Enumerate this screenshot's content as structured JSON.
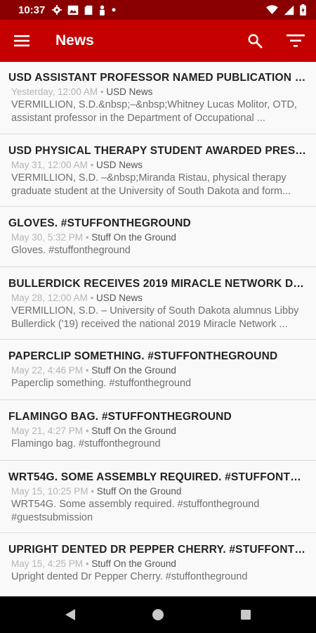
{
  "status_bar": {
    "time": "10:37",
    "icons_left": [
      "gear-icon",
      "photo-icon",
      "sd-card-icon",
      "person-icon",
      "dot-icon"
    ],
    "icons_right": [
      "wifi-icon",
      "signal-icon",
      "battery-icon"
    ]
  },
  "app_bar": {
    "title": "News",
    "menu_icon": "hamburger-menu-icon",
    "search_icon": "search-icon",
    "filter_icon": "filter-icon",
    "color": "#c40000"
  },
  "news": [
    {
      "title": "USD ASSISTANT PROFESSOR NAMED PUBLICATION E...",
      "date": "Yesterday, 12:00 AM",
      "source": "USD News",
      "summary": "VERMILLION, S.D.&nbsp;–&nbsp;Whitney Lucas Molitor, OTD, assistant professor in the Department of Occupational ..."
    },
    {
      "title": "USD PHYSICAL THERAPY STUDENT AWARDED PRESTI...",
      "date": "May 31, 12:00 AM",
      "source": "USD News",
      "summary": "VERMILLION, S.D. –&nbsp;Miranda Ristau, physical therapy graduate student at the University of South Dakota and form..."
    },
    {
      "title": "GLOVES. #STUFFONTHEGROUND",
      "date": "May 30, 5:32 PM",
      "source": "Stuff On the Ground",
      "summary": "Gloves. #stuffontheground"
    },
    {
      "title": "BULLERDICK RECEIVES 2019 MIRACLE NETWORK DAN...",
      "date": "May 28, 12:00 AM",
      "source": "USD News",
      "summary": "VERMILLION, S.D. – University of South Dakota alumnus Libby Bullerdick ('19) received the national 2019 Miracle Network ..."
    },
    {
      "title": "PAPERCLIP SOMETHING. #STUFFONTHEGROUND",
      "date": "May 22, 4:46 PM",
      "source": "Stuff On the Ground",
      "summary": "Paperclip something. #stuffontheground"
    },
    {
      "title": "FLAMINGO BAG. #STUFFONTHEGROUND",
      "date": "May 21, 4:27 PM",
      "source": "Stuff On the Ground",
      "summary": "Flamingo bag. #stuffontheground"
    },
    {
      "title": "WRT54G. SOME ASSEMBLY REQUIRED.  #STUFFONTHE...",
      "date": "May 15, 10:25 PM",
      "source": "Stuff On the Ground",
      "summary": "WRT54G. Some assembly required. #stuffontheground #guestsubmission"
    },
    {
      "title": "UPRIGHT DENTED DR PEPPER CHERRY. #STUFFONTHE...",
      "date": "May 15, 4:25 PM",
      "source": "Stuff On the Ground",
      "summary": "Upright dented Dr Pepper Cherry. #stuffontheground"
    }
  ],
  "meta_separator": " • ",
  "nav_bar": {
    "back_icon": "back-triangle-icon",
    "home_icon": "home-circle-icon",
    "recents_icon": "recents-square-icon"
  }
}
